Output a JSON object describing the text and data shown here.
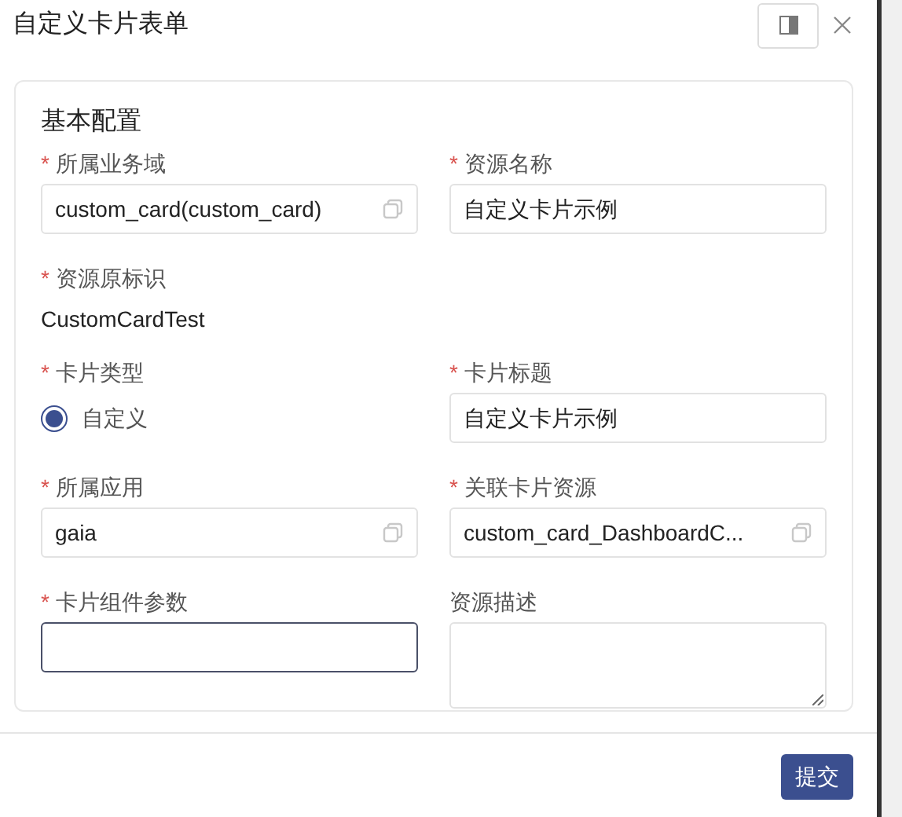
{
  "dialog": {
    "title": "自定义卡片表单"
  },
  "section": {
    "title": "基本配置"
  },
  "fields": [
    {
      "kind": "input",
      "required_mark": "*",
      "label": "所属业务域",
      "value": "custom_card(custom_card)",
      "copyable": true,
      "focused": false
    },
    {
      "kind": "input",
      "required_mark": "*",
      "label": "资源名称",
      "value": "自定义卡片示例",
      "copyable": false,
      "focused": false
    },
    {
      "kind": "text",
      "required_mark": "*",
      "label": "资源原标识",
      "value": "CustomCardTest"
    },
    {
      "kind": "empty"
    },
    {
      "kind": "radio",
      "required_mark": "*",
      "label": "卡片类型",
      "options": [
        {
          "label": "自定义",
          "selected": true
        }
      ]
    },
    {
      "kind": "input",
      "required_mark": "*",
      "label": "卡片标题",
      "value": "自定义卡片示例",
      "copyable": false,
      "focused": false
    },
    {
      "kind": "input",
      "required_mark": "*",
      "label": "所属应用",
      "value": "gaia",
      "copyable": true,
      "focused": false
    },
    {
      "kind": "input",
      "required_mark": "*",
      "label": "关联卡片资源",
      "value": "custom_card_DashboardC...",
      "copyable": true,
      "focused": false
    },
    {
      "kind": "input",
      "required_mark": "*",
      "label": "卡片组件参数",
      "copyable": false,
      "focused": true
    },
    {
      "kind": "textarea",
      "label": "资源描述"
    }
  ],
  "footer": {
    "submit": "提交"
  }
}
